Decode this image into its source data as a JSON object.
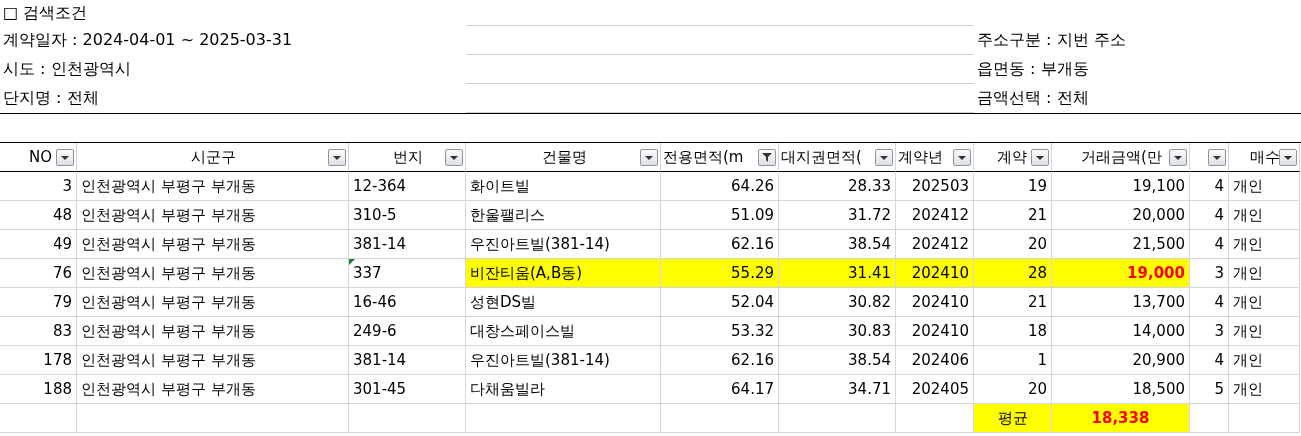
{
  "search_conditions": {
    "title": "□ 검색조건",
    "left": [
      "계약일자 : 2024-04-01 ~ 2025-03-31",
      "시도 : 인천광역시",
      "단지명 : 전체"
    ],
    "right": [
      "주소구분 : 지번 주소",
      "읍면동 : 부개동",
      "금액선택 : 전체"
    ]
  },
  "table": {
    "columns": [
      {
        "label": "NO",
        "filtered": false
      },
      {
        "label": "시군구",
        "filtered": false
      },
      {
        "label": "번지",
        "filtered": false
      },
      {
        "label": "건물명",
        "filtered": false
      },
      {
        "label": "전용면적(m",
        "filtered": true
      },
      {
        "label": "대지권면적(",
        "filtered": false
      },
      {
        "label": "계약년",
        "filtered": false
      },
      {
        "label": "계약",
        "filtered": false
      },
      {
        "label": "거래금액(만",
        "filtered": false
      },
      {
        "filtered": false
      },
      {
        "label": "매수",
        "filtered": false
      }
    ],
    "rows": [
      {
        "cells": [
          "3",
          "인천광역시 부평구 부개동",
          "12-364",
          "화이트빌",
          "64.26",
          "28.33",
          "202503",
          "19",
          "19,100",
          "4",
          "개인"
        ],
        "highlighted": false,
        "flagged": false
      },
      {
        "cells": [
          "48",
          "인천광역시 부평구 부개동",
          "310-5",
          "한울팰리스",
          "51.09",
          "31.72",
          "202412",
          "21",
          "20,000",
          "4",
          "개인"
        ],
        "highlighted": false,
        "flagged": false
      },
      {
        "cells": [
          "49",
          "인천광역시 부평구 부개동",
          "381-14",
          "우진아트빌(381-14)",
          "62.16",
          "38.54",
          "202412",
          "20",
          "21,500",
          "4",
          "개인"
        ],
        "highlighted": false,
        "flagged": false
      },
      {
        "cells": [
          "76",
          "인천광역시 부평구 부개동",
          "337",
          "비잔티움(A,B동)",
          "55.29",
          "31.41",
          "202410",
          "28",
          "19,000",
          "3",
          "개인"
        ],
        "highlighted": true,
        "flagged": true
      },
      {
        "cells": [
          "79",
          "인천광역시 부평구 부개동",
          "16-46",
          "성현DS빌",
          "52.04",
          "30.82",
          "202410",
          "21",
          "13,700",
          "4",
          "개인"
        ],
        "highlighted": false,
        "flagged": false
      },
      {
        "cells": [
          "83",
          "인천광역시 부평구 부개동",
          "249-6",
          "대창스페이스빌",
          "53.32",
          "30.83",
          "202410",
          "18",
          "14,000",
          "3",
          "개인"
        ],
        "highlighted": false,
        "flagged": false
      },
      {
        "cells": [
          "178",
          "인천광역시 부평구 부개동",
          "381-14",
          "우진아트빌(381-14)",
          "62.16",
          "38.54",
          "202406",
          "1",
          "20,900",
          "4",
          "개인"
        ],
        "highlighted": false,
        "flagged": false
      },
      {
        "cells": [
          "188",
          "인천광역시 부평구 부개동",
          "301-45",
          "다채움빌라",
          "64.17",
          "34.71",
          "202405",
          "20",
          "18,500",
          "5",
          "개인"
        ],
        "highlighted": false,
        "flagged": false
      }
    ],
    "average": {
      "label": "평균",
      "value": "18,338"
    }
  }
}
